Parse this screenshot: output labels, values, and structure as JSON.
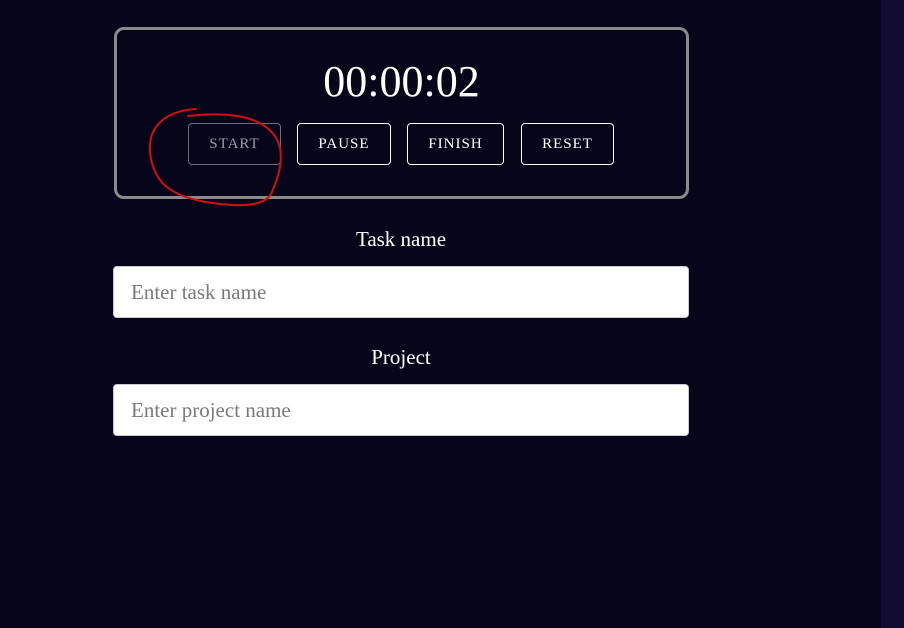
{
  "timer": {
    "display": "00:00:02"
  },
  "controls": {
    "start_label": "START",
    "pause_label": "PAUSE",
    "finish_label": "FINISH",
    "reset_label": "RESET"
  },
  "form": {
    "task_label": "Task name",
    "task_placeholder": "Enter task name",
    "task_value": "",
    "project_label": "Project",
    "project_placeholder": "Enter project name",
    "project_value": ""
  },
  "annotation": {
    "color": "#d01010",
    "shape": "hand-drawn circle around start button"
  },
  "colors": {
    "background": "#07051a",
    "side_strip": "#120c33",
    "timer_border": "#8a8a8a"
  }
}
